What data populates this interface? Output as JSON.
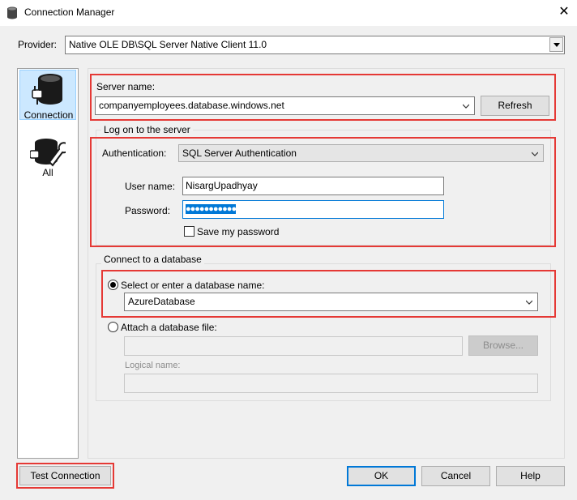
{
  "window": {
    "title": "Connection Manager",
    "close_glyph": "✕"
  },
  "provider": {
    "label": "Provider:",
    "value": "Native OLE DB\\SQL Server Native Client 11.0"
  },
  "nav": {
    "items": [
      {
        "label": "Connection",
        "icon": "database-plug-icon",
        "active": true
      },
      {
        "label": "All",
        "icon": "database-wrench-icon",
        "active": false
      }
    ]
  },
  "server": {
    "label": "Server name:",
    "value": "companyemployees.database.windows.net",
    "refresh_label": "Refresh"
  },
  "logon": {
    "group_label": "Log on to the server",
    "auth_label": "Authentication:",
    "auth_value": "SQL Server Authentication",
    "user_label": "User name:",
    "user_value": "NisargUpadhyay",
    "password_label": "Password:",
    "password_value": "●●●●●●●●●●●",
    "save_password_label": "Save my password"
  },
  "database": {
    "group_label": "Connect to a database",
    "select_label": "Select or enter a database name:",
    "select_value": "AzureDatabase",
    "attach_label": "Attach a database file:",
    "attach_value": "",
    "browse_label": "Browse...",
    "logical_label": "Logical name:",
    "logical_value": ""
  },
  "footer": {
    "test_label": "Test Connection",
    "ok_label": "OK",
    "cancel_label": "Cancel",
    "help_label": "Help"
  },
  "colors": {
    "highlight_border": "#e53935",
    "selection": "#0078d7",
    "nav_active": "#cce8ff"
  }
}
